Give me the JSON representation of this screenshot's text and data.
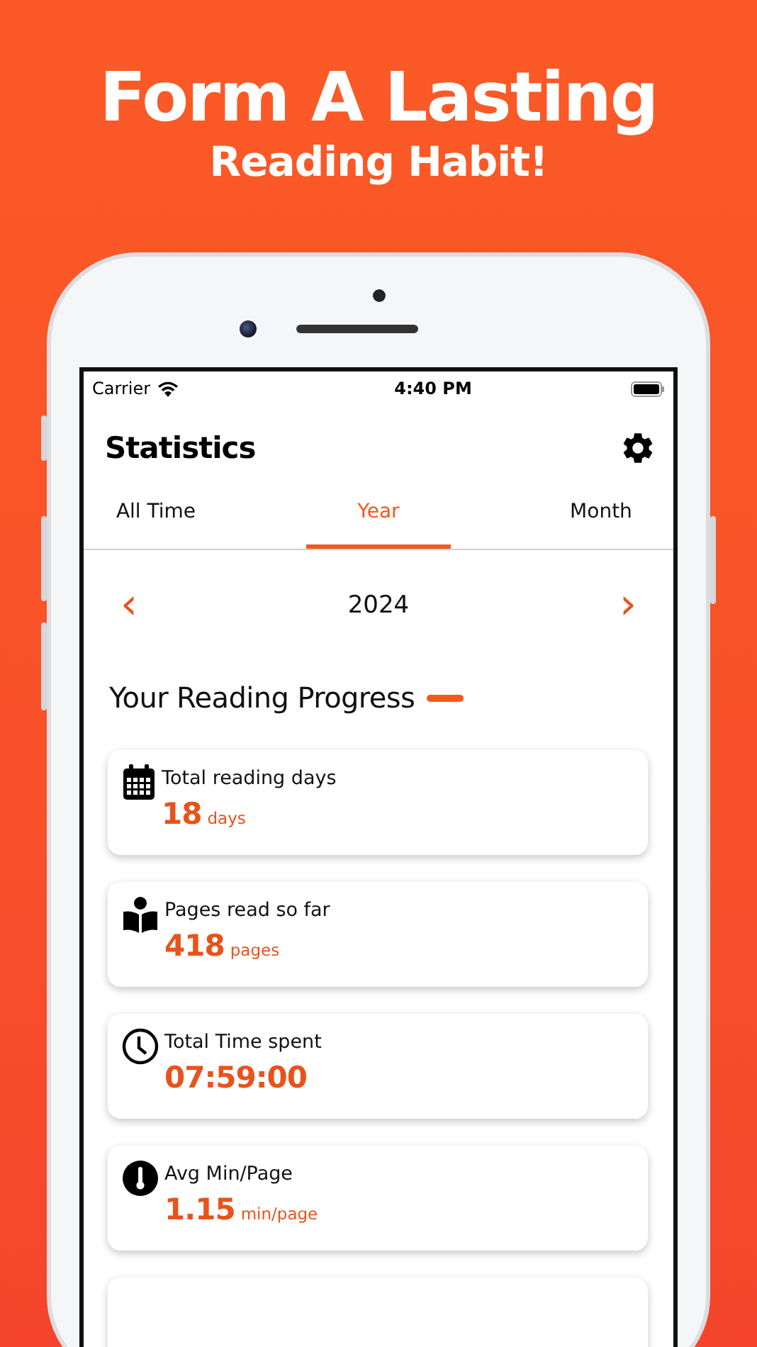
{
  "headline": {
    "title": "Form A Lasting",
    "subtitle": "Reading Habit!"
  },
  "status_bar": {
    "carrier": "Carrier",
    "time": "4:40 PM"
  },
  "header": {
    "title": "Statistics"
  },
  "tabs": [
    {
      "label": "All Time",
      "selected": false
    },
    {
      "label": "Year",
      "selected": true
    },
    {
      "label": "Month",
      "selected": false
    }
  ],
  "period": {
    "prev": "‹",
    "label": "2024",
    "next": "›"
  },
  "section": {
    "title": "Your Reading Progress"
  },
  "stats": [
    {
      "kind": "days",
      "label": "Total reading days",
      "value": "18",
      "unit": "days"
    },
    {
      "kind": "pages",
      "label": "Pages read so far",
      "value": "418",
      "unit": "pages"
    },
    {
      "kind": "time",
      "label": "Total Time spent",
      "value": "07:59:00"
    },
    {
      "kind": "pace",
      "label": "Avg Min/Page",
      "value": "1.15",
      "unit": "min/page"
    }
  ]
}
